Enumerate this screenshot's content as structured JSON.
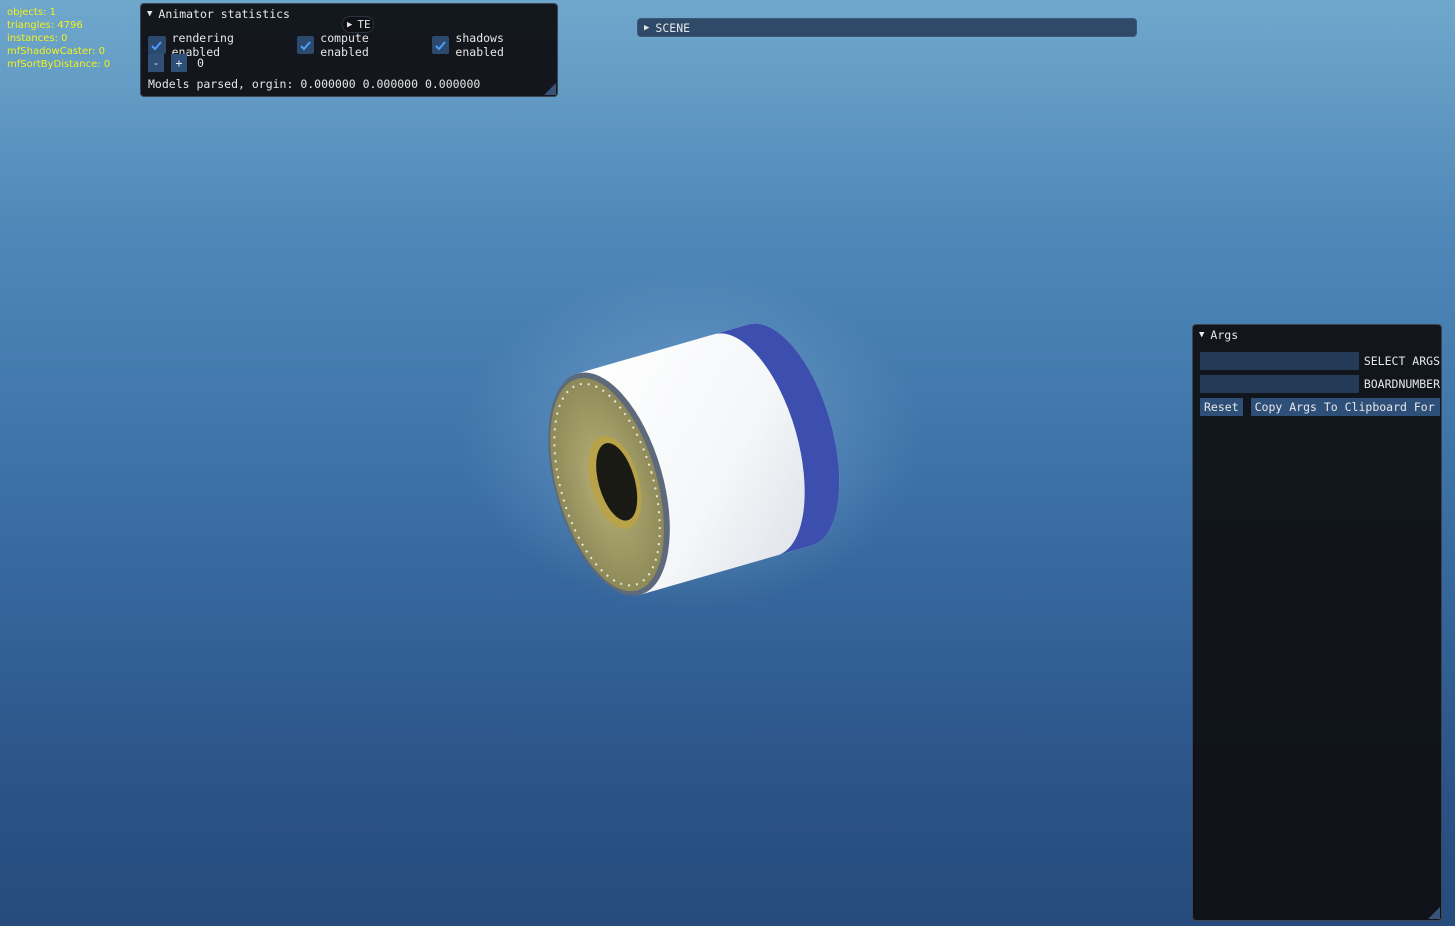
{
  "stats": {
    "objects": "objects: 1",
    "triangles": "triangles: 4796",
    "instances": "instances: 0",
    "shadow_caster": "mfShadowCaster: 0",
    "sort_by_distance": "mfSortByDistance: 0"
  },
  "animator": {
    "title": "Animator statistics",
    "rendering_label": "rendering enabled",
    "compute_label": "compute enabled",
    "shadows_label": "shadows enabled",
    "minus_label": "-",
    "plus_label": "+",
    "counter_value": "0",
    "models_text": "Models parsed, orgin: 0.000000 0.000000 0.000000",
    "overlap_tab": "TE"
  },
  "scene": {
    "title": "SCENE"
  },
  "args": {
    "title": "Args",
    "select_args_label": "SELECT ARGS",
    "board_number_label": "BOARDNUMBER",
    "select_args_value": "",
    "board_number_value": "",
    "reset_label": "Reset",
    "copy_label": "Copy Args To Clipboard For E"
  },
  "colors": {
    "stats_text": "#f2f21a",
    "accent": "#2e4f78",
    "check": "#4a9eff"
  }
}
